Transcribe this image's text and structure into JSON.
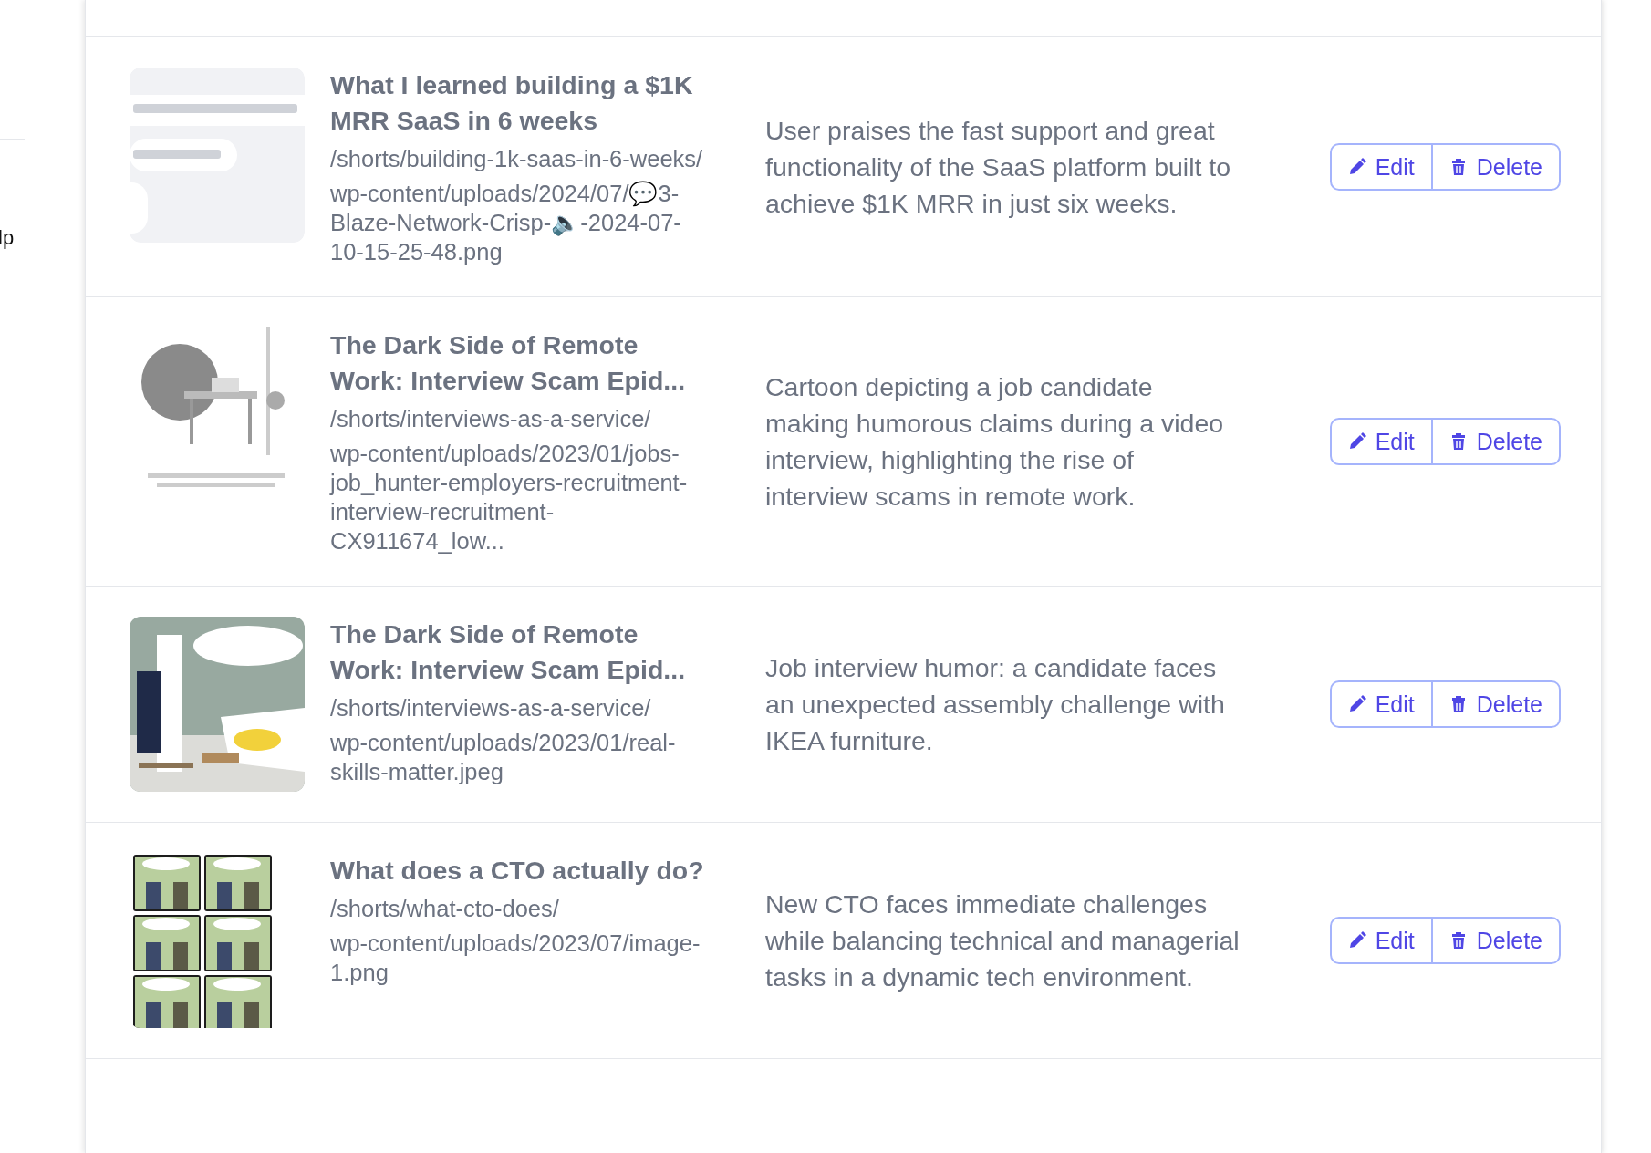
{
  "sidebar": {
    "label": "lp"
  },
  "rows": [
    {
      "title": "What I learned building a $1K MRR SaaS in 6 weeks",
      "slug": "/shorts/building-1k-saas-in-6-weeks/",
      "file": "wp-content/uploads/2024/07/💬3-Blaze-Network-Crisp-🔈-2024-07-10-15-25-48.png",
      "description": "User praises the fast support and great functionality of the SaaS platform built to achieve $1K MRR in just six weeks.",
      "actions": [
        "Edit",
        "Delete"
      ]
    },
    {
      "title": "The Dark Side of Remote Work: Interview Scam Epid...",
      "slug": "/shorts/interviews-as-a-service/",
      "file": "wp-content/uploads/2023/01/jobs-job_hunter-employers-recruitment-interview-recruitment-CX911674_low...",
      "description": "Cartoon depicting a job candidate making humorous claims during a video interview, highlighting the rise of interview scams in remote work.",
      "actions": [
        "Edit",
        "Delete"
      ]
    },
    {
      "title": "The Dark Side of Remote Work: Interview Scam Epid...",
      "slug": "/shorts/interviews-as-a-service/",
      "file": "wp-content/uploads/2023/01/real-skills-matter.jpeg",
      "description": "Job interview humor: a candidate faces an unexpected assembly challenge with IKEA furniture.",
      "actions": [
        "Edit",
        "Delete"
      ]
    },
    {
      "title": "What does a CTO actually do?",
      "slug": "/shorts/what-cto-does/",
      "file": "wp-content/uploads/2023/07/image-1.png",
      "description": "New CTO faces immediate challenges while balancing technical and managerial tasks in a dynamic tech environment.",
      "actions": [
        "Edit",
        "Delete"
      ]
    }
  ]
}
